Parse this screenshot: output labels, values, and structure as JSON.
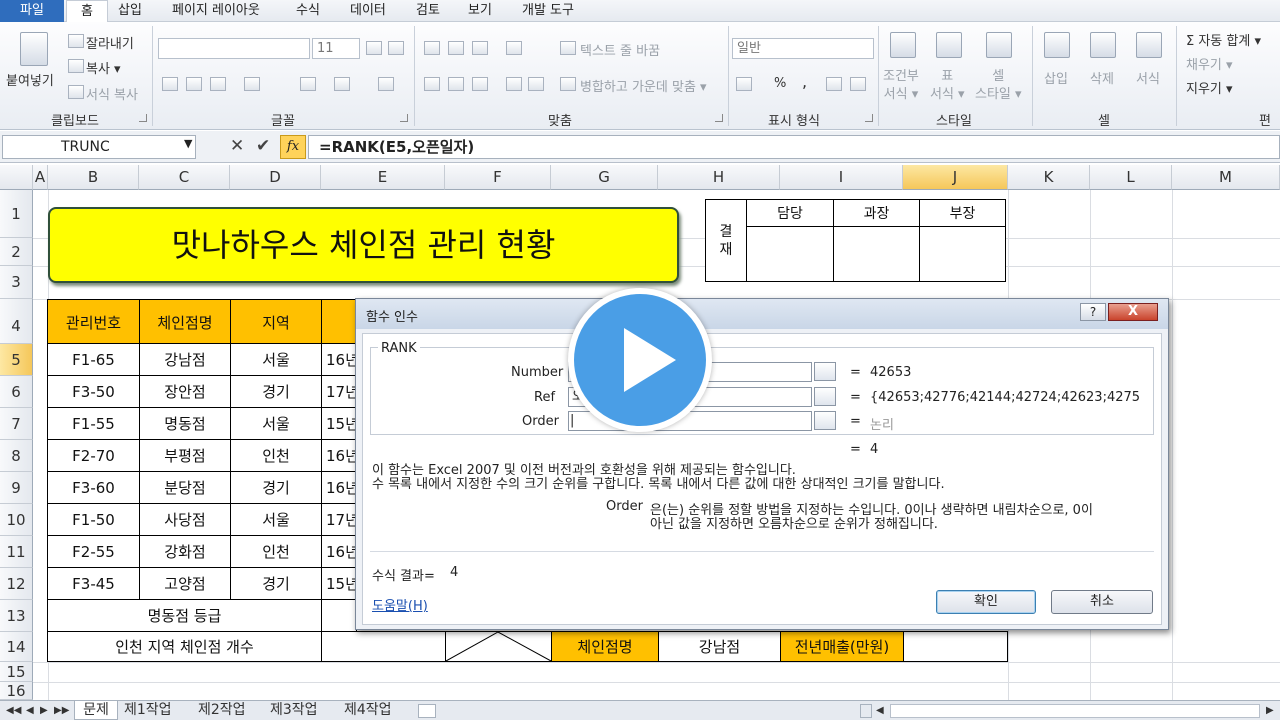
{
  "menu": {
    "file": "파일",
    "tabs": [
      "홈",
      "삽입",
      "페이지 레이아웃",
      "수식",
      "데이터",
      "검토",
      "보기",
      "개발 도구"
    ]
  },
  "ribbon": {
    "clipboard": {
      "paste": "붙여넣기",
      "cut": "잘라내기",
      "copy": "복사 ▾",
      "format_painter": "서식 복사",
      "label": "클립보드"
    },
    "font": {
      "font_size": "11",
      "label": "글꼴"
    },
    "alignment": {
      "wrap": "텍스트 줄 바꿈",
      "merge": "병합하고 가운데 맞춤 ▾",
      "label": "맞춤"
    },
    "number": {
      "format": "일반",
      "label": "표시 형식",
      "percent": "%",
      "comma": ","
    },
    "styles": {
      "conditional": "조건부\n서식 ▾",
      "table": "표\n서식 ▾",
      "cell": "셀\n스타일 ▾",
      "label": "스타일"
    },
    "cells": {
      "insert": "삽입",
      "delete": "삭제",
      "format": "서식",
      "label": "셀"
    },
    "editing": {
      "autosum": "Σ 자동 합계 ▾",
      "fill": "채우기 ▾",
      "clear": "지우기 ▾",
      "label": "편"
    }
  },
  "formula_bar": {
    "name_box": "TRUNC",
    "fx": "fx",
    "formula": "=RANK(E5,오픈일자)"
  },
  "columns": [
    "A",
    "B",
    "C",
    "D",
    "E",
    "F",
    "G",
    "H",
    "I",
    "J",
    "K",
    "L",
    "M"
  ],
  "rows": [
    "1",
    "2",
    "3",
    "4",
    "5",
    "6",
    "7",
    "8",
    "9",
    "10",
    "11",
    "12",
    "13",
    "14",
    "15",
    "16"
  ],
  "sheet": {
    "title": "맛나하우스 체인점 관리 현황",
    "approval": {
      "label": "결\n재",
      "cols": [
        "담당",
        "과장",
        "부장"
      ]
    },
    "headers": [
      "관리번호",
      "체인점명",
      "지역"
    ],
    "data": [
      [
        "F1-65",
        "강남점",
        "서울",
        "16년"
      ],
      [
        "F3-50",
        "장안점",
        "경기",
        "17년"
      ],
      [
        "F1-55",
        "명동점",
        "서울",
        "15년"
      ],
      [
        "F2-70",
        "부평점",
        "인천",
        "16년"
      ],
      [
        "F3-60",
        "분당점",
        "경기",
        "16년"
      ],
      [
        "F1-50",
        "사당점",
        "서울",
        "17년"
      ],
      [
        "F2-55",
        "강화점",
        "인천",
        "16년"
      ],
      [
        "F3-45",
        "고양점",
        "경기",
        "15년"
      ]
    ],
    "row13_label": "명동점 등급",
    "row14_label": "인천 지역 체인점 개수",
    "row14_g": "체인점명",
    "row14_h": "강남점",
    "row14_i": "전년매출(만원)"
  },
  "dialog": {
    "title": "함수 인수",
    "func": "RANK",
    "args": [
      {
        "name": "Number",
        "value": "",
        "result": "42653"
      },
      {
        "name": "Ref",
        "value": "오",
        "result": "{42653;42776;42144;42724;42623;42755;424"
      },
      {
        "name": "Order",
        "value": "|",
        "result": "논리"
      }
    ],
    "eq": "=",
    "overall_result": "4",
    "desc1": "이 함수는 Excel 2007 및 이전 버전과의 호환성을 위해 제공되는 함수입니다.",
    "desc2": "수 목록 내에서 지정한 수의 크기 순위를 구합니다. 목록 내에서 다른 값에 대한 상대적인 크기를 말합니다.",
    "arg_name": "Order",
    "arg_desc1": "은(는) 순위를 정할 방법을 지정하는 수입니다. 0이나 생략하면 내림차순으로, 0이",
    "arg_desc2": "아닌 값을 지정하면 오름차순으로 순위가 정해집니다.",
    "formula_result_label": "수식 결과=",
    "formula_result": "4",
    "help_link": "도움말(H)",
    "ok": "확인",
    "cancel": "취소",
    "help_btn": "?",
    "close_btn": "X"
  },
  "tabs": [
    "문제",
    "제1작업",
    "제2작업",
    "제3작업",
    "제4작업"
  ],
  "colors": {
    "accent": "#2f6dbd",
    "header_fill": "#ffc000",
    "title_fill": "#ffff00",
    "play": "#4a9ee6"
  },
  "overlay": {
    "icon": "play-icon"
  }
}
